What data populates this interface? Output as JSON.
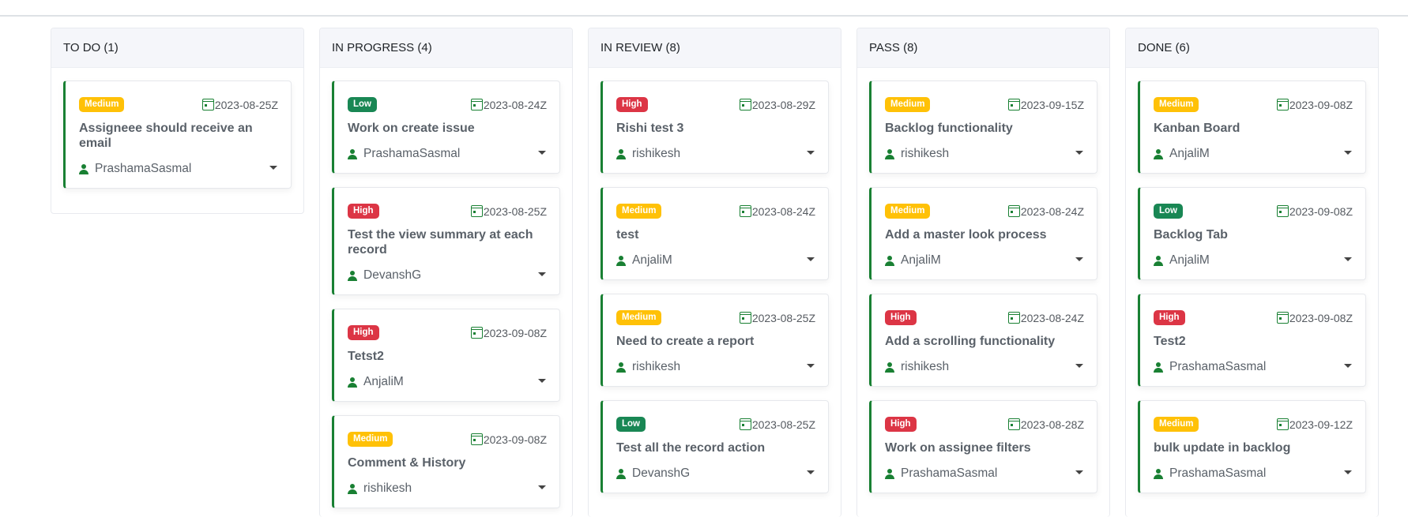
{
  "columns": [
    {
      "header": "TO DO (1)",
      "cards": [
        {
          "priority": "Medium",
          "priority_color": "#ffc107",
          "date": "2023-08-25Z",
          "title": "Assigneee should receive an email",
          "assignee": "PrashamaSasmal"
        }
      ]
    },
    {
      "header": "IN PROGRESS (4)",
      "cards": [
        {
          "priority": "Low",
          "priority_color": "#198754",
          "date": "2023-08-24Z",
          "title": "Work on create issue",
          "assignee": "PrashamaSasmal"
        },
        {
          "priority": "High",
          "priority_color": "#dc3545",
          "date": "2023-08-25Z",
          "title": "Test the view summary at each record",
          "assignee": "DevanshG"
        },
        {
          "priority": "High",
          "priority_color": "#dc3545",
          "date": "2023-09-08Z",
          "title": "Tetst2",
          "assignee": "AnjaliM"
        },
        {
          "priority": "Medium",
          "priority_color": "#ffc107",
          "date": "2023-09-08Z",
          "title": "Comment & History",
          "assignee": "rishikesh"
        }
      ]
    },
    {
      "header": "IN REVIEW (8)",
      "cards": [
        {
          "priority": "High",
          "priority_color": "#dc3545",
          "date": "2023-08-29Z",
          "title": "Rishi test 3",
          "assignee": "rishikesh"
        },
        {
          "priority": "Medium",
          "priority_color": "#ffc107",
          "date": "2023-08-24Z",
          "title": "test",
          "assignee": "AnjaliM"
        },
        {
          "priority": "Medium",
          "priority_color": "#ffc107",
          "date": "2023-08-25Z",
          "title": "Need to create a report",
          "assignee": "rishikesh"
        },
        {
          "priority": "Low",
          "priority_color": "#198754",
          "date": "2023-08-25Z",
          "title": "Test all the record action",
          "assignee": "DevanshG"
        }
      ]
    },
    {
      "header": "PASS (8)",
      "cards": [
        {
          "priority": "Medium",
          "priority_color": "#ffc107",
          "date": "2023-09-15Z",
          "title": "Backlog functionality",
          "assignee": "rishikesh"
        },
        {
          "priority": "Medium",
          "priority_color": "#ffc107",
          "date": "2023-08-24Z",
          "title": "Add a master look process",
          "assignee": "AnjaliM"
        },
        {
          "priority": "High",
          "priority_color": "#dc3545",
          "date": "2023-08-24Z",
          "title": "Add a scrolling functionality",
          "assignee": "rishikesh"
        },
        {
          "priority": "High",
          "priority_color": "#dc3545",
          "date": "2023-08-28Z",
          "title": "Work on assignee filters",
          "assignee": "PrashamaSasmal"
        }
      ]
    },
    {
      "header": "DONE (6)",
      "cards": [
        {
          "priority": "Medium",
          "priority_color": "#ffc107",
          "date": "2023-09-08Z",
          "title": "Kanban Board",
          "assignee": "AnjaliM"
        },
        {
          "priority": "Low",
          "priority_color": "#198754",
          "date": "2023-09-08Z",
          "title": "Backlog Tab",
          "assignee": "AnjaliM"
        },
        {
          "priority": "High",
          "priority_color": "#dc3545",
          "date": "2023-09-08Z",
          "title": "Test2",
          "assignee": "PrashamaSasmal"
        },
        {
          "priority": "Medium",
          "priority_color": "#ffc107",
          "date": "2023-09-12Z",
          "title": "bulk update in backlog",
          "assignee": "PrashamaSasmal"
        }
      ]
    }
  ],
  "icons": {
    "date": "calendar-icon",
    "assignee": "person-icon",
    "menu": "caret-down-icon"
  },
  "colors": {
    "accent": "#198033",
    "header_bg": "#f5f6fa"
  }
}
